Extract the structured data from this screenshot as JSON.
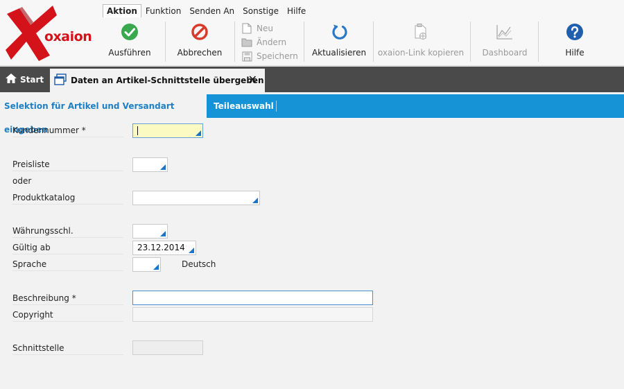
{
  "app": {
    "brand": "oxaion"
  },
  "menu": {
    "items": [
      {
        "label": "Aktion",
        "active": true
      },
      {
        "label": "Funktion"
      },
      {
        "label": "Senden An"
      },
      {
        "label": "Sonstige"
      },
      {
        "label": "Hilfe"
      }
    ]
  },
  "toolbar": {
    "execute": "Ausführen",
    "cancel": "Abbrechen",
    "new": "Neu",
    "edit": "Ändern",
    "save": "Speichern",
    "refresh": "Aktualisieren",
    "copy_link": "oxaion-Link kopieren",
    "dashboard": "Dashboard",
    "help": "Hilfe"
  },
  "colors": {
    "accent_blue": "#1593d6",
    "brand_red": "#d4121a",
    "execute_green": "#3aa84e",
    "cancel_red": "#d83a2c",
    "refresh_blue": "#2a78c6",
    "help_blue": "#1f5fae"
  },
  "tabs": {
    "start": "Start",
    "active": "Daten an Artikel-Schnittstelle übergeben"
  },
  "subtabs": {
    "first": "Selektion für Artikel und Versandart eingeben",
    "second": "Teileauswahl"
  },
  "form": {
    "customer_number_label": "Kundennummer *",
    "customer_number_value": "",
    "price_list_label": "Preisliste",
    "or_label": "oder",
    "product_catalog_label": "Produktkatalog",
    "currency_label": "Währungsschl.",
    "valid_from_label": "Gültig ab",
    "valid_from_value": "23.12.2014",
    "language_label": "Sprache",
    "language_name": "Deutsch",
    "description_label": "Beschreibung *",
    "description_value": "",
    "copyright_label": "Copyright",
    "copyright_value": "",
    "interface_label": "Schnittstelle",
    "interface_value": ""
  }
}
